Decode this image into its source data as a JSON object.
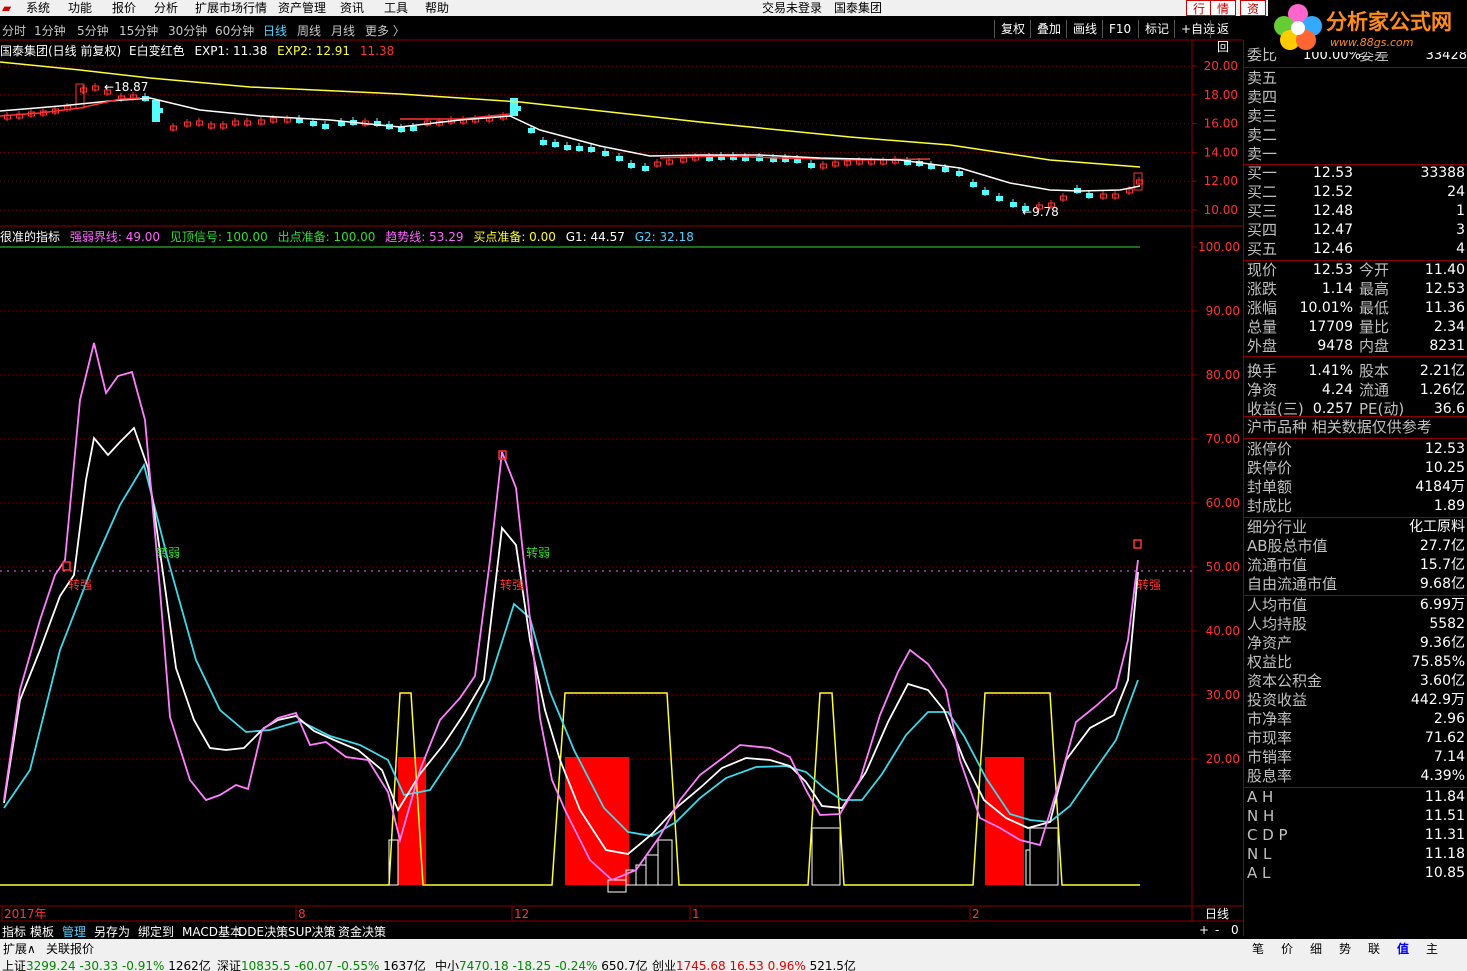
{
  "menu": {
    "items": [
      "系统",
      "功能",
      "报价",
      "分析",
      "扩展市场行情",
      "资产管理",
      "资讯",
      "工具",
      "帮助"
    ],
    "center": [
      "交易未登录",
      "国泰集团"
    ],
    "right_buttons": [
      "行",
      "情",
      "资"
    ]
  },
  "logo": {
    "text": "分析家公式网",
    "url": "www.88gs.com"
  },
  "toolbar": {
    "periods": [
      "分时",
      "1分钟",
      "5分钟",
      "15分钟",
      "30分钟",
      "60分钟",
      "日线",
      "周线",
      "月线",
      "更多 〉"
    ],
    "active": "日线",
    "right": [
      "复权",
      "叠加",
      "画线",
      "F10",
      "标记",
      "+自选",
      "返回"
    ]
  },
  "main_info": {
    "title": "国泰集团(日线 前复权)",
    "color_note": "E白变红色",
    "exp1_label": "EXP1: 11.38",
    "exp2_label": "EXP2: 12.91",
    "exp3_label": "11.38"
  },
  "price_axis": {
    "ticks": [
      "20.00",
      "18.00",
      "16.00",
      "14.00",
      "12.00",
      "10.00"
    ]
  },
  "price_marks": {
    "high": "18.87",
    "low": "9.78"
  },
  "indicator_info": {
    "name": "很准的指标",
    "qrj": "强弱界线: 49.00",
    "jd": "见顶信号: 100.00",
    "ck": "出点准备: 100.00",
    "qs": "趋势线: 53.29",
    "mr": "买点准备: 0.00",
    "g1": "G1: 44.57",
    "g2": "G2: 32.18"
  },
  "ind_axis": {
    "ticks": [
      "100.00",
      "90.00",
      "80.00",
      "70.00",
      "60.00",
      "50.00",
      "40.00",
      "30.00",
      "20.00"
    ]
  },
  "signals": {
    "weak": "转弱",
    "strong": "转强"
  },
  "time_axis": {
    "labels": [
      "2017年",
      "8",
      "12",
      "1",
      "2"
    ],
    "period": "日线"
  },
  "bottom_tabs": [
    "指标",
    "模板",
    "管理",
    "另存为",
    "绑定到",
    "MACD基本",
    "DDE决策",
    "SUP决策",
    "资金决策"
  ],
  "zoom_controls": [
    "+",
    "-",
    "0"
  ],
  "right_tabs": [
    "笔",
    "价",
    "细",
    "势",
    "联",
    "值",
    "主"
  ],
  "ext_bar": [
    "扩展∧",
    "关联报价"
  ],
  "order_book": {
    "weibi_label": "委比",
    "weibi_value": "100.00%",
    "weicha_label": "委差",
    "weicha_value": "33428",
    "sell": [
      {
        "label": "卖五",
        "price": "",
        "vol": ""
      },
      {
        "label": "卖四",
        "price": "",
        "vol": ""
      },
      {
        "label": "卖三",
        "price": "",
        "vol": ""
      },
      {
        "label": "卖二",
        "price": "",
        "vol": ""
      },
      {
        "label": "卖一",
        "price": "",
        "vol": ""
      }
    ],
    "buy": [
      {
        "label": "买一",
        "price": "12.53",
        "vol": "33388"
      },
      {
        "label": "买二",
        "price": "12.52",
        "vol": "24"
      },
      {
        "label": "买三",
        "price": "12.48",
        "vol": "1"
      },
      {
        "label": "买四",
        "price": "12.47",
        "vol": "3"
      },
      {
        "label": "买五",
        "price": "12.46",
        "vol": "4"
      }
    ]
  },
  "quote": [
    {
      "k1": "现价",
      "v1": "12.53",
      "c1": "red",
      "k2": "今开",
      "v2": "11.40",
      "c2": "red"
    },
    {
      "k1": "涨跌",
      "v1": "1.14",
      "c1": "red",
      "k2": "最高",
      "v2": "12.53",
      "c2": "red"
    },
    {
      "k1": "涨幅",
      "v1": "10.01%",
      "c1": "red",
      "k2": "最低",
      "v2": "11.36",
      "c2": "green"
    },
    {
      "k1": "总量",
      "v1": "17709",
      "c1": "yellow",
      "k2": "量比",
      "v2": "2.34",
      "c2": "red"
    },
    {
      "k1": "外盘",
      "v1": "9478",
      "c1": "red",
      "k2": "内盘",
      "v2": "8231",
      "c2": "green"
    },
    {
      "k1": "换手",
      "v1": "1.41%",
      "c1": "white",
      "k2": "股本",
      "v2": "2.21亿",
      "c2": "white"
    },
    {
      "k1": "净资",
      "v1": "4.24",
      "c1": "white",
      "k2": "流通",
      "v2": "1.26亿",
      "c2": "white"
    },
    {
      "k1": "收益(三)",
      "v1": "0.257",
      "c1": "white",
      "k2": "PE(动)",
      "v2": "36.6",
      "c2": "white"
    }
  ],
  "market_title": "沪市品种 相关数据仅供参考",
  "limits": [
    {
      "k": "涨停价",
      "v": "12.53",
      "c": "red"
    },
    {
      "k": "跌停价",
      "v": "10.25",
      "c": "green"
    },
    {
      "k": "封单额",
      "v": "4184万",
      "c": "red"
    },
    {
      "k": "封成比",
      "v": "1.89",
      "c": "red"
    }
  ],
  "fundamentals": [
    {
      "k": "细分行业",
      "v": "化工原料"
    },
    {
      "k": "AB股总市值",
      "v": "27.7亿"
    },
    {
      "k": "流通市值",
      "v": "15.7亿"
    },
    {
      "k": "自由流通市值",
      "v": "9.68亿"
    },
    {
      "k": "人均市值",
      "v": "6.99万"
    },
    {
      "k": "人均持股",
      "v": "5582"
    },
    {
      "k": "净资产",
      "v": "9.36亿"
    },
    {
      "k": "权益比",
      "v": "75.85%"
    },
    {
      "k": "资本公积金",
      "v": "3.60亿"
    },
    {
      "k": "投资收益",
      "v": "442.9万"
    },
    {
      "k": "市净率",
      "v": "2.96"
    },
    {
      "k": "市现率",
      "v": "71.62"
    },
    {
      "k": "市销率",
      "v": "7.14"
    },
    {
      "k": "股息率",
      "v": "4.39%"
    }
  ],
  "cost_lines": [
    {
      "k": "A H",
      "v": "11.84",
      "c": "red"
    },
    {
      "k": "N H",
      "v": "11.51",
      "c": "red"
    },
    {
      "k": "C D P",
      "v": "11.31",
      "c": "green"
    },
    {
      "k": "N L",
      "v": "11.18",
      "c": "green"
    },
    {
      "k": "A L",
      "v": "10.85",
      "c": "yellow"
    }
  ],
  "status": [
    {
      "name": "上证",
      "val": "3299.24",
      "chg": "-30.33",
      "pct": "-0.91%",
      "amt": "1262亿"
    },
    {
      "name": "深证",
      "val": "10835.5",
      "chg": "-60.07",
      "pct": "-0.55%",
      "amt": "1637亿"
    },
    {
      "name": "中小",
      "val": "7470.18",
      "chg": "-18.25",
      "pct": "-0.24%",
      "amt": "650.7亿"
    },
    {
      "name": "创业",
      "val": "1745.68",
      "chg": "16.53",
      "pct": "0.96%",
      "amt": "521.5亿"
    }
  ],
  "colors": {
    "up": "#ff3333",
    "down": "#54fcfc",
    "ma_white": "#ffffff",
    "ma_yellow": "#ffff33",
    "pink": "#ff80ff",
    "cyan": "#3fd8e8",
    "border": "#8b0000"
  }
}
